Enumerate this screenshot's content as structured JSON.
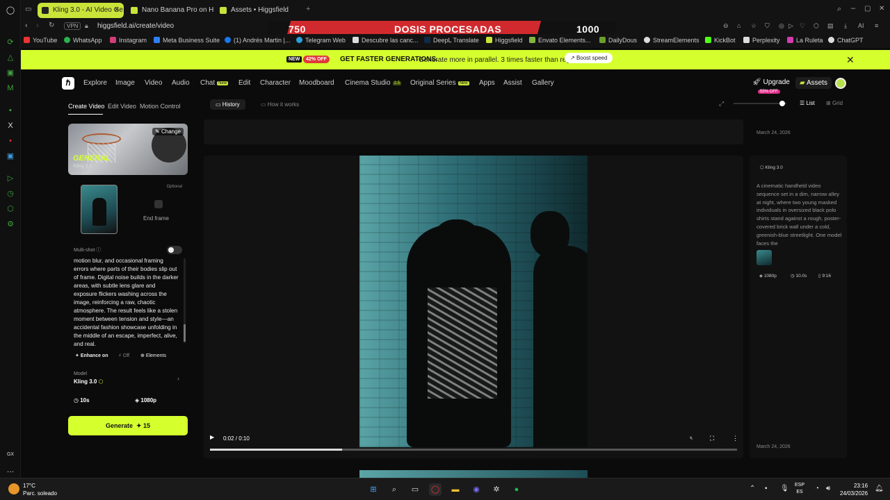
{
  "browser": {
    "tabs": [
      {
        "label": "Kling 3.0 - AI Video Ge",
        "active": true
      },
      {
        "label": "Nano Banana Pro on Higg",
        "active": false
      },
      {
        "label": "Assets • Higgsfield",
        "active": false
      }
    ],
    "url": "higgsfield.ai/create/video",
    "vpn_label": "VPN",
    "bookmarks": [
      "YouTube",
      "WhatsApp",
      "Instagram",
      "Meta Business Suite",
      "(1) Andrés Martin |...",
      "Telegram Web",
      "Descubre las canc...",
      "DeepL Translate",
      "Higgsfield",
      "Envato Elements...",
      "DailyDous",
      "StreamElements",
      "KickBot",
      "Perplexity",
      "La Ruleta",
      "ChatGPT"
    ]
  },
  "overlay": {
    "left": "750",
    "center": "DOSIS PROCESADAS",
    "right": "1000"
  },
  "promo": {
    "new_badge": "NEW",
    "off_badge": "42% OFF",
    "headline": "GET FASTER GENERATIONS.",
    "text": "Generate more in parallel. 3 times faster than regular",
    "boost": "Boost speed"
  },
  "nav": {
    "items": [
      "Explore",
      "Image",
      "Video",
      "Audio",
      "Chat",
      "Edit",
      "Character",
      "Moodboard",
      "Cinema Studio",
      "Original Series",
      "Apps",
      "Assist",
      "Gallery"
    ],
    "new_tag": "New",
    "cinema_tag": "2.5",
    "upgrade": "Upgrade",
    "upgrade_badge": "55% OFF",
    "assets": "Assets"
  },
  "left_panel": {
    "subtabs": [
      "Create Video",
      "Edit Video",
      "Motion Control"
    ],
    "preset_title": "GENERAL",
    "preset_sub": "Kling 3.0",
    "change": "Change",
    "optional": "Optional",
    "end_frame": "End frame",
    "multishot": "Multi-shot",
    "prompt": "motion blur, and occasional framing errors where parts of their bodies slip out of frame. Digital noise builds in the darker areas, with subtle lens glare and exposure flickers washing across the image, reinforcing a raw, chaotic atmosphere. The result feels like a stolen moment between tension and style—an accidental fashion showcase unfolding in the middle of an escape, imperfect, alive, and real.",
    "enhance": "Enhance on",
    "off": "Off",
    "elements": "Elements",
    "model_label": "Model",
    "model_value": "Kling 3.0",
    "duration": "10s",
    "resolution": "1080p",
    "generate": "Generate",
    "cost": "15"
  },
  "main": {
    "history": "History",
    "how": "How it works",
    "list": "List",
    "grid": "Grid",
    "time": "0:02 / 0:10",
    "progress": 0.25
  },
  "right_panel": {
    "date1": "March 24, 2026",
    "model": "Kling 3.0",
    "description": "A cinematic handheld video sequence set in a dim, narrow alley at night, where two young masked individuals in oversized black polo shirts stand against a rough, poster-covered brick wall under a cold, greenish-blue streetlight. One model faces the",
    "res": "1080p",
    "dur": "10.0s",
    "ratio": "9:16",
    "date2": "March 24, 2026"
  },
  "taskbar": {
    "temp": "17°C",
    "weather": "Parc. soleado",
    "lang1": "ESP",
    "lang2": "ES",
    "time": "23:16",
    "date": "24/03/2026"
  }
}
